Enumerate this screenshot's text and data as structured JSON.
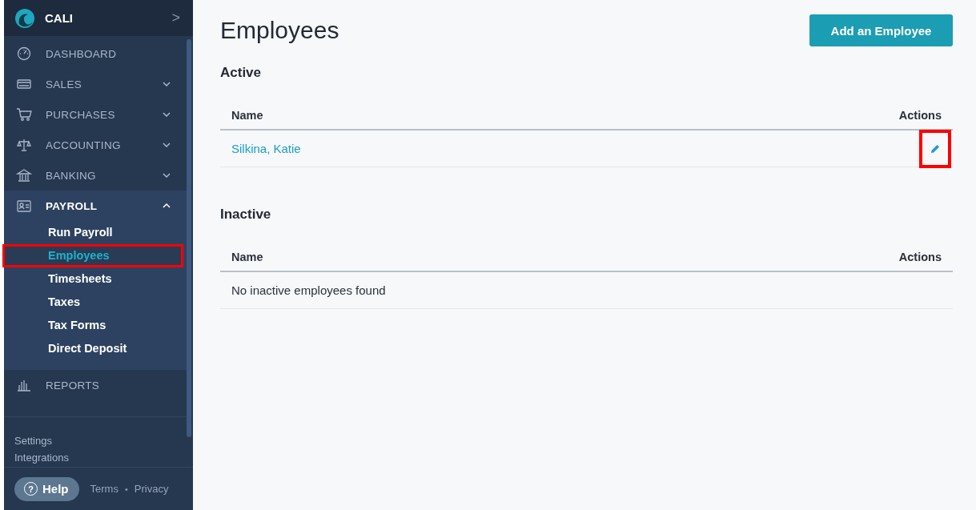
{
  "sidebar": {
    "brand": "CALI",
    "brand_arrow": ">",
    "items": [
      {
        "label": "DASHBOARD"
      },
      {
        "label": "SALES",
        "expanded": false
      },
      {
        "label": "PURCHASES",
        "expanded": false
      },
      {
        "label": "ACCOUNTING",
        "expanded": false
      },
      {
        "label": "BANKING",
        "expanded": false
      },
      {
        "label": "PAYROLL",
        "expanded": true,
        "children": [
          {
            "label": "Run Payroll",
            "selected": false,
            "highlighted": false
          },
          {
            "label": "Employees",
            "selected": true,
            "highlighted": true
          },
          {
            "label": "Timesheets",
            "selected": false,
            "highlighted": false
          },
          {
            "label": "Taxes",
            "selected": false,
            "highlighted": false
          },
          {
            "label": "Tax Forms",
            "selected": false,
            "highlighted": false
          },
          {
            "label": "Direct Deposit",
            "selected": false,
            "highlighted": false
          }
        ]
      },
      {
        "label": "REPORTS"
      }
    ],
    "links": [
      "Settings",
      "Integrations"
    ],
    "help": "Help",
    "help_icon": "?",
    "footer_links": [
      "Terms",
      "Privacy"
    ],
    "footer_separator": "•"
  },
  "page": {
    "title": "Employees",
    "button": "Add an Employee",
    "sections": [
      {
        "title": "Active",
        "columns": [
          "Name",
          "Actions"
        ],
        "rows": [
          {
            "name": "Silkina, Katie",
            "edit_highlighted": true
          }
        ]
      },
      {
        "title": "Inactive",
        "columns": [
          "Name",
          "Actions"
        ],
        "empty": "No inactive employees found"
      }
    ]
  }
}
